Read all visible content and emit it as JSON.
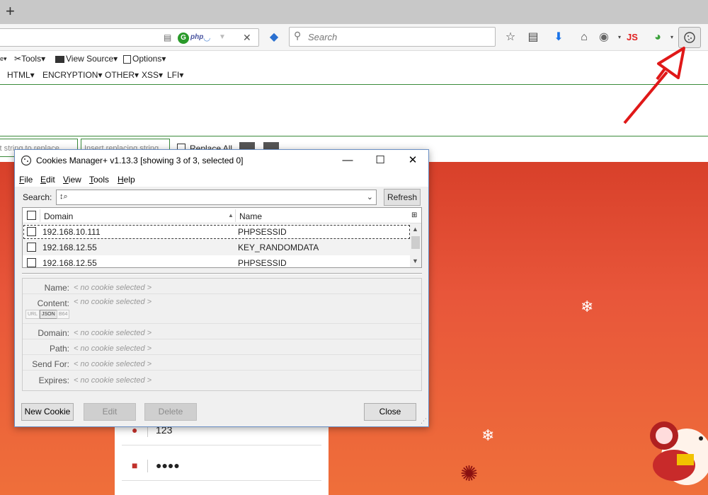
{
  "browser": {
    "new_tab_symbol": "+",
    "search_placeholder": "Search",
    "url_icons": {
      "php_label": "php"
    },
    "nav_icons": [
      "star-icon",
      "reading-list-icon",
      "download-icon",
      "home-icon",
      "globe-icon",
      "js-icon",
      "network-icon",
      "cookie-icon"
    ],
    "js_label": "JS",
    "accent_red": "#e02020"
  },
  "hackbar": {
    "toolbar1": {
      "tools_label": "Tools",
      "view_source_label": "View Source",
      "options_label": "Options"
    },
    "toolbar2": [
      "HTML",
      "ENCRYPTION",
      "OTHER",
      "XSS",
      "LFI"
    ],
    "replace": {
      "find_placeholder": "Insert string to replace",
      "replace_placeholder": "Insert replacing string",
      "replace_all_label": "Replace All"
    }
  },
  "page": {
    "login_rows": [
      {
        "icon": "user-icon",
        "value": "123"
      },
      {
        "icon": "lock-icon",
        "value": "●●●●"
      }
    ]
  },
  "dialog": {
    "title": "Cookies Manager+ v1.13.3 [showing 3 of 3, selected 0]",
    "window_buttons": {
      "minimize": "—",
      "maximize": "☐",
      "close": "✕"
    },
    "menu": [
      {
        "accel": "F",
        "rest": "ile"
      },
      {
        "accel": "E",
        "rest": "dit"
      },
      {
        "accel": "V",
        "rest": "iew"
      },
      {
        "accel": "T",
        "rest": "ools"
      },
      {
        "accel": "H",
        "rest": "elp"
      }
    ],
    "search_label": "Search:",
    "refresh_label": "Refresh",
    "columns": {
      "domain": "Domain",
      "name": "Name"
    },
    "cookies": [
      {
        "domain": "192.168.10.111",
        "name": "PHPSESSID"
      },
      {
        "domain": "192.168.12.55",
        "name": "KEY_RANDOMDATA"
      },
      {
        "domain": "192.168.12.55",
        "name": "PHPSESSID"
      }
    ],
    "details": {
      "no_selection": "< no cookie selected >",
      "formats": [
        "URL",
        "JSON",
        "B64"
      ],
      "fields": [
        {
          "label": "Name:"
        },
        {
          "label": "Content:"
        },
        {
          "label": "Domain:"
        },
        {
          "label": "Path:"
        },
        {
          "label": "Send For:"
        },
        {
          "label": "Expires:"
        }
      ]
    },
    "buttons": {
      "new_cookie": "New Cookie",
      "edit": "Edit",
      "delete": "Delete",
      "close": "Close"
    }
  }
}
